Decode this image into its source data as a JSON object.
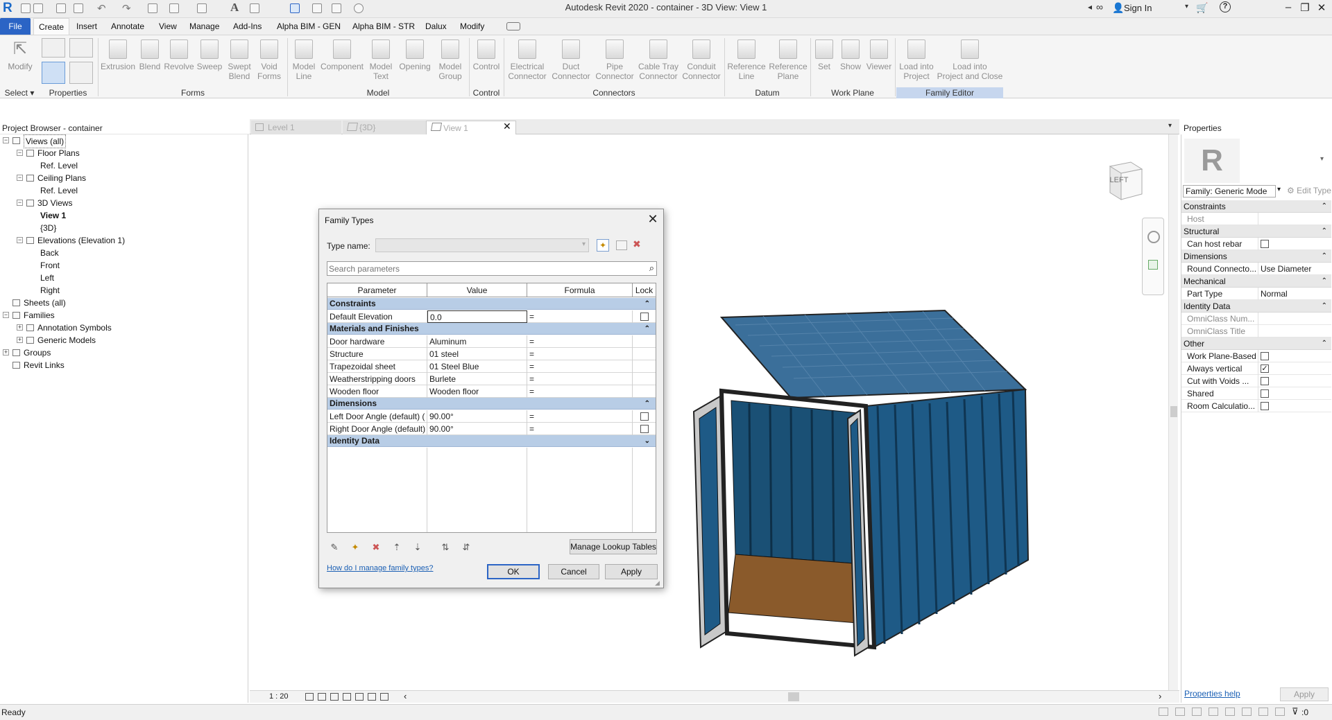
{
  "window": {
    "title": "Autodesk Revit 2020 - container - 3D View: View 1",
    "sign_in": "Sign In"
  },
  "menu": [
    "File",
    "Create",
    "Insert",
    "Annotate",
    "View",
    "Manage",
    "Add-Ins",
    "Alpha BIM - GEN",
    "Alpha BIM - STR",
    "Dalux",
    "Modify"
  ],
  "ribbon": {
    "buttons": [
      {
        "label": "Modify"
      },
      {
        "label": "Extrusion"
      },
      {
        "label": "Blend"
      },
      {
        "label": "Revolve"
      },
      {
        "label": "Sweep"
      },
      {
        "label": "Swept\nBlend"
      },
      {
        "label": "Void\nForms"
      },
      {
        "label": "Model\nLine"
      },
      {
        "label": "Component"
      },
      {
        "label": "Model\nText"
      },
      {
        "label": "Opening"
      },
      {
        "label": "Model\nGroup"
      },
      {
        "label": "Control"
      },
      {
        "label": "Electrical\nConnector"
      },
      {
        "label": "Duct\nConnector"
      },
      {
        "label": "Pipe\nConnector"
      },
      {
        "label": "Cable Tray\nConnector"
      },
      {
        "label": "Conduit\nConnector"
      },
      {
        "label": "Reference\nLine"
      },
      {
        "label": "Reference\nPlane"
      },
      {
        "label": "Set"
      },
      {
        "label": "Show"
      },
      {
        "label": "Viewer"
      },
      {
        "label": "Load into\nProject"
      },
      {
        "label": "Load into\nProject and Close"
      }
    ],
    "panels": [
      "Select",
      "Properties",
      "Forms",
      "Model",
      "Control",
      "Connectors",
      "Datum",
      "Work Plane",
      "Family Editor"
    ]
  },
  "project_browser": {
    "title": "Project Browser - container",
    "nodes": [
      {
        "label": "Views (all)",
        "level": 0,
        "toggle": "-",
        "bold": false
      },
      {
        "label": "Floor Plans",
        "level": 1,
        "toggle": "-",
        "bold": false
      },
      {
        "label": "Ref. Level",
        "level": 2,
        "toggle": "",
        "bold": false
      },
      {
        "label": "Ceiling Plans",
        "level": 1,
        "toggle": "-",
        "bold": false
      },
      {
        "label": "Ref. Level",
        "level": 2,
        "toggle": "",
        "bold": false
      },
      {
        "label": "3D Views",
        "level": 1,
        "toggle": "-",
        "bold": false
      },
      {
        "label": "View 1",
        "level": 2,
        "toggle": "",
        "bold": true
      },
      {
        "label": "{3D}",
        "level": 2,
        "toggle": "",
        "bold": false
      },
      {
        "label": "Elevations (Elevation 1)",
        "level": 1,
        "toggle": "-",
        "bold": false
      },
      {
        "label": "Back",
        "level": 2,
        "toggle": "",
        "bold": false
      },
      {
        "label": "Front",
        "level": 2,
        "toggle": "",
        "bold": false
      },
      {
        "label": "Left",
        "level": 2,
        "toggle": "",
        "bold": false
      },
      {
        "label": "Right",
        "level": 2,
        "toggle": "",
        "bold": false
      },
      {
        "label": "Sheets (all)",
        "level": 0,
        "toggle": "",
        "bold": false
      },
      {
        "label": "Families",
        "level": 0,
        "toggle": "-",
        "bold": false
      },
      {
        "label": "Annotation Symbols",
        "level": 1,
        "toggle": "+",
        "bold": false
      },
      {
        "label": "Generic Models",
        "level": 1,
        "toggle": "+",
        "bold": false
      },
      {
        "label": "Groups",
        "level": 0,
        "toggle": "+",
        "bold": false
      },
      {
        "label": "Revit Links",
        "level": 0,
        "toggle": "",
        "bold": false
      }
    ]
  },
  "view_tabs": [
    "Level 1",
    "{3D}",
    "View 1"
  ],
  "viewcube": "LEFT",
  "view_scale": "1 : 20",
  "properties": {
    "title": "Properties",
    "type_selector": "Family: Generic Mode",
    "edit_type": "Edit Type",
    "groups": [
      {
        "name": "Constraints",
        "rows": [
          {
            "name": "Host",
            "value": "",
            "check": null,
            "disabled": true
          }
        ]
      },
      {
        "name": "Structural",
        "rows": [
          {
            "name": "Can host rebar",
            "value": "",
            "check": false,
            "disabled": false
          }
        ]
      },
      {
        "name": "Dimensions",
        "rows": [
          {
            "name": "Round Connecto...",
            "value": "Use Diameter",
            "check": null,
            "disabled": false
          }
        ]
      },
      {
        "name": "Mechanical",
        "rows": [
          {
            "name": "Part Type",
            "value": "Normal",
            "check": null,
            "disabled": false
          }
        ]
      },
      {
        "name": "Identity Data",
        "rows": [
          {
            "name": "OmniClass Num...",
            "value": "",
            "check": null,
            "disabled": true
          },
          {
            "name": "OmniClass Title",
            "value": "",
            "check": null,
            "disabled": true
          }
        ]
      },
      {
        "name": "Other",
        "rows": [
          {
            "name": "Work Plane-Based",
            "value": "",
            "check": false,
            "disabled": false
          },
          {
            "name": "Always vertical",
            "value": "",
            "check": true,
            "disabled": false
          },
          {
            "name": "Cut with Voids ...",
            "value": "",
            "check": false,
            "disabled": false
          },
          {
            "name": "Shared",
            "value": "",
            "check": false,
            "disabled": false
          },
          {
            "name": "Room Calculatio...",
            "value": "",
            "check": false,
            "disabled": false
          }
        ]
      }
    ],
    "help_link": "Properties help",
    "apply": "Apply"
  },
  "status": {
    "text": "Ready",
    "filter_count": ":0"
  },
  "dialog": {
    "title": "Family Types",
    "type_name_label": "Type name:",
    "search_placeholder": "Search parameters",
    "columns": [
      "Parameter",
      "Value",
      "Formula",
      "Lock"
    ],
    "sections": [
      {
        "name": "Constraints",
        "collapse": "^",
        "rows": [
          {
            "param": "Default Elevation",
            "value": "0.0",
            "formula": "=",
            "lock": true,
            "editing": true
          }
        ]
      },
      {
        "name": "Materials and Finishes",
        "collapse": "^",
        "rows": [
          {
            "param": "Door hardware",
            "value": "Aluminum",
            "formula": "=",
            "lock": false,
            "editing": false
          },
          {
            "param": "Structure",
            "value": "01 steel",
            "formula": "=",
            "lock": false,
            "editing": false
          },
          {
            "param": "Trapezoidal sheet",
            "value": "01 Steel Blue",
            "formula": "=",
            "lock": false,
            "editing": false
          },
          {
            "param": "Weatherstripping doors",
            "value": "Burlete",
            "formula": "=",
            "lock": false,
            "editing": false
          },
          {
            "param": "Wooden floor",
            "value": "Wooden floor",
            "formula": "=",
            "lock": false,
            "editing": false
          }
        ]
      },
      {
        "name": "Dimensions",
        "collapse": "^",
        "rows": [
          {
            "param": "Left Door Angle (default) (",
            "value": "90.00°",
            "formula": "=",
            "lock": true,
            "editing": false
          },
          {
            "param": "Right Door Angle (default)",
            "value": "90.00°",
            "formula": "=",
            "lock": true,
            "editing": false
          }
        ]
      },
      {
        "name": "Identity Data",
        "collapse": "v",
        "rows": []
      }
    ],
    "manage_lookup": "Manage Lookup Tables",
    "help_link": "How do I manage family types?",
    "ok": "OK",
    "cancel": "Cancel",
    "apply": "Apply"
  },
  "colors": {
    "accent": "#2b64c5",
    "section": "#b8cde6",
    "container_blue": "#1e5a86",
    "floor": "#8a5a2b"
  }
}
